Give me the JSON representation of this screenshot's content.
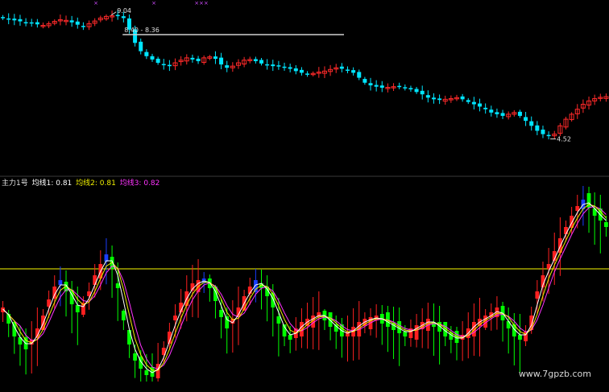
{
  "chart_data": [
    {
      "type": "candlestick",
      "title": "",
      "ylim": [
        4.3,
        9.3
      ],
      "annotations": {
        "high_label": "9.04",
        "range_label": "8.40 - 8.36",
        "low_label": "4.52",
        "markers": [
          "×",
          "×",
          "×××"
        ]
      },
      "series": [
        {
          "name": "price",
          "values": [
            8.95,
            8.92,
            8.88,
            8.85,
            8.82,
            8.8,
            8.76,
            8.73,
            8.78,
            8.85,
            8.9,
            8.88,
            8.82,
            8.75,
            8.7,
            8.78,
            8.86,
            8.95,
            9.0,
            9.02,
            9.04,
            8.95,
            8.6,
            8.2,
            7.95,
            7.8,
            7.7,
            7.6,
            7.55,
            7.5,
            7.6,
            7.68,
            7.75,
            7.7,
            7.65,
            7.75,
            7.78,
            7.72,
            7.55,
            7.45,
            7.5,
            7.6,
            7.68,
            7.7,
            7.65,
            7.58,
            7.55,
            7.5,
            7.52,
            7.48,
            7.42,
            7.35,
            7.3,
            7.25,
            7.28,
            7.32,
            7.35,
            7.4,
            7.45,
            7.42,
            7.38,
            7.3,
            7.15,
            7.0,
            6.92,
            6.88,
            6.85,
            6.86,
            6.88,
            6.9,
            6.85,
            6.8,
            6.72,
            6.65,
            6.55,
            6.5,
            6.48,
            6.5,
            6.52,
            6.55,
            6.5,
            6.42,
            6.35,
            6.28,
            6.2,
            6.1,
            6.05,
            6.0,
            6.05,
            6.1,
            6.0,
            5.85,
            5.7,
            5.55,
            5.45,
            5.4,
            5.45,
            5.7,
            5.9,
            6.05,
            6.2,
            6.35,
            6.45,
            6.52,
            6.56,
            6.58
          ]
        }
      ]
    },
    {
      "type": "bar",
      "title": "",
      "ylim": [
        0,
        1.2
      ],
      "legend": {
        "name": "主力1号",
        "items": [
          {
            "label": "均线1: 0.81",
            "color": "#ffffff"
          },
          {
            "label": "均线2: 0.81",
            "color": "#f0f000"
          },
          {
            "label": "均线3: 0.82",
            "color": "#ff33ff"
          }
        ]
      },
      "reference_line": 0.7,
      "series": [
        {
          "name": "主力1号",
          "values": [
            0.45,
            0.38,
            0.3,
            0.25,
            0.22,
            0.25,
            0.32,
            0.4,
            0.5,
            0.58,
            0.62,
            0.58,
            0.5,
            0.45,
            0.48,
            0.55,
            0.65,
            0.72,
            0.78,
            0.72,
            0.6,
            0.4,
            0.25,
            0.15,
            0.1,
            0.06,
            0.05,
            0.1,
            0.2,
            0.3,
            0.4,
            0.48,
            0.55,
            0.6,
            0.62,
            0.63,
            0.6,
            0.52,
            0.42,
            0.35,
            0.38,
            0.45,
            0.52,
            0.58,
            0.62,
            0.6,
            0.55,
            0.48,
            0.38,
            0.3,
            0.28,
            0.32,
            0.36,
            0.38,
            0.4,
            0.42,
            0.4,
            0.36,
            0.33,
            0.3,
            0.3,
            0.33,
            0.36,
            0.38,
            0.39,
            0.4,
            0.38,
            0.36,
            0.34,
            0.32,
            0.3,
            0.32,
            0.34,
            0.36,
            0.38,
            0.36,
            0.33,
            0.3,
            0.28,
            0.26,
            0.28,
            0.32,
            0.36,
            0.38,
            0.4,
            0.42,
            0.45,
            0.4,
            0.35,
            0.3,
            0.28,
            0.3,
            0.4,
            0.55,
            0.65,
            0.72,
            0.8,
            0.88,
            0.95,
            1.02,
            1.08,
            1.12,
            1.1,
            1.05,
            1.02,
            0.98
          ]
        }
      ]
    }
  ],
  "watermark": "www.7gpzb.com",
  "colors": {
    "up": "#ff2a2a",
    "down": "#00e5ff",
    "osc_up": "#ff2020",
    "osc_down": "#00ff00",
    "osc_top": "#1a3dff",
    "ref_line": "#c8c800",
    "text": "#e0e0e0"
  }
}
